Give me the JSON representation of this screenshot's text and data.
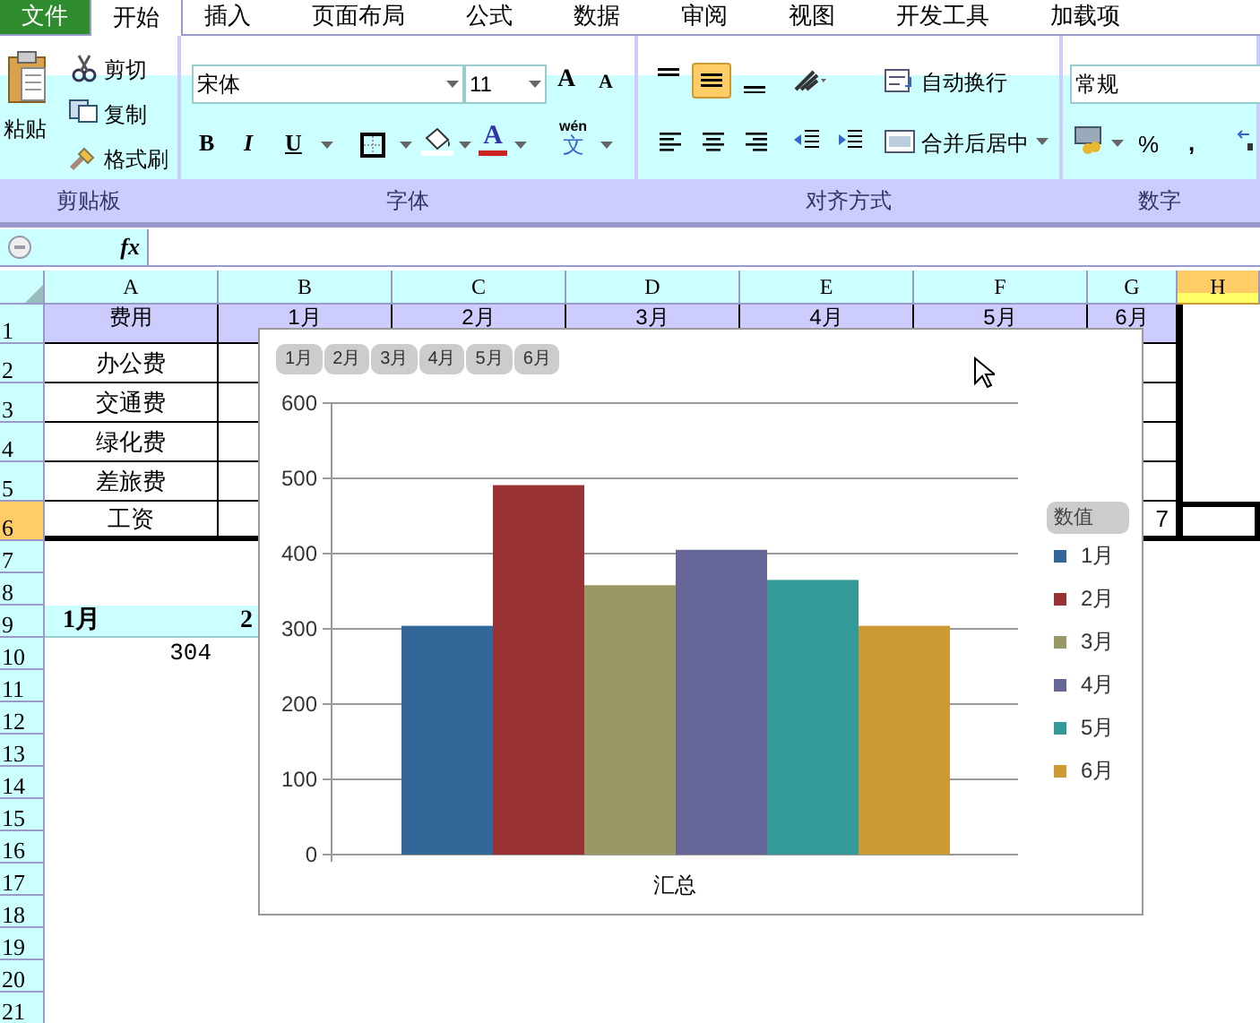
{
  "tabs": [
    {
      "label": "文件",
      "kind": "file",
      "selected": false
    },
    {
      "label": "开始",
      "kind": "tab",
      "selected": true
    },
    {
      "label": "插入",
      "kind": "tab",
      "selected": false
    },
    {
      "label": "页面布局",
      "kind": "tab",
      "selected": false
    },
    {
      "label": "公式",
      "kind": "tab",
      "selected": false
    },
    {
      "label": "数据",
      "kind": "tab",
      "selected": false
    },
    {
      "label": "审阅",
      "kind": "tab",
      "selected": false
    },
    {
      "label": "视图",
      "kind": "tab",
      "selected": false
    },
    {
      "label": "开发工具",
      "kind": "tab",
      "selected": false
    },
    {
      "label": "加载项",
      "kind": "tab",
      "selected": false
    }
  ],
  "clipboard": {
    "paste": "粘贴",
    "cut": "剪切",
    "copy": "复制",
    "format_painter": "格式刷",
    "label": "剪贴板"
  },
  "font": {
    "name": "宋体",
    "size": "11",
    "grow": "A",
    "shrink": "A",
    "bold": "B",
    "italic": "I",
    "underline": "U",
    "font_color": "A",
    "phonetic_top": "wén",
    "phonetic_bottom": "文",
    "label": "字体"
  },
  "alignment": {
    "vertical": [
      {
        "kind": "top",
        "selected": false
      },
      {
        "kind": "middle",
        "selected": true
      },
      {
        "kind": "bottom",
        "selected": false
      }
    ],
    "horizontal": [
      {
        "kind": "left",
        "selected": false
      },
      {
        "kind": "center",
        "selected": false
      },
      {
        "kind": "right",
        "selected": false
      }
    ],
    "wrap": "自动换行",
    "merge": "合并后居中",
    "label": "对齐方式"
  },
  "number": {
    "format": "常规",
    "percent": "%",
    "comma": ",",
    "label": "数字"
  },
  "formula_bar": {
    "function_label": "fx"
  },
  "sheet": {
    "columns": [
      {
        "label": "A",
        "selected": false
      },
      {
        "label": "B",
        "selected": false
      },
      {
        "label": "C",
        "selected": false
      },
      {
        "label": "D",
        "selected": false
      },
      {
        "label": "E",
        "selected": false
      },
      {
        "label": "F",
        "selected": false
      },
      {
        "label": "G",
        "selected": false
      },
      {
        "label": "H",
        "selected": true
      }
    ],
    "rows": [
      {
        "header": "1",
        "kind": "header",
        "selected": false,
        "cells": [
          "费用",
          "1月",
          "2月",
          "3月",
          "4月",
          "5月",
          "6月"
        ]
      },
      {
        "header": "2",
        "kind": "data",
        "selected": false,
        "cells": [
          "办公费"
        ]
      },
      {
        "header": "3",
        "kind": "data",
        "selected": false,
        "cells": [
          "交通费"
        ]
      },
      {
        "header": "4",
        "kind": "data",
        "selected": false,
        "cells": [
          "绿化费"
        ]
      },
      {
        "header": "5",
        "kind": "data",
        "selected": false,
        "cells": [
          "差旅费"
        ]
      },
      {
        "header": "6",
        "kind": "data",
        "selected": true,
        "cells": [
          "工资",
          null,
          null,
          null,
          null,
          null,
          "7"
        ]
      },
      {
        "header": "7",
        "kind": "plain",
        "selected": false,
        "cells": []
      },
      {
        "header": "8",
        "kind": "plain",
        "selected": false,
        "cells": []
      },
      {
        "header": "9",
        "kind": "pivot",
        "selected": false,
        "cells": [
          "1月",
          "2"
        ]
      },
      {
        "header": "10",
        "kind": "value",
        "selected": false,
        "cells": [
          "304"
        ]
      },
      {
        "header": "11",
        "kind": "plain",
        "selected": false,
        "cells": []
      },
      {
        "header": "12",
        "kind": "plain",
        "selected": false,
        "cells": []
      },
      {
        "header": "13",
        "kind": "plain",
        "selected": false,
        "cells": []
      },
      {
        "header": "14",
        "kind": "plain",
        "selected": false,
        "cells": []
      },
      {
        "header": "15",
        "kind": "plain",
        "selected": false,
        "cells": []
      },
      {
        "header": "16",
        "kind": "plain",
        "selected": false,
        "cells": []
      },
      {
        "header": "17",
        "kind": "plain",
        "selected": false,
        "cells": []
      },
      {
        "header": "18",
        "kind": "plain",
        "selected": false,
        "cells": []
      },
      {
        "header": "19",
        "kind": "plain",
        "selected": false,
        "cells": []
      },
      {
        "header": "20",
        "kind": "plain",
        "selected": false,
        "cells": []
      },
      {
        "header": "21",
        "kind": "plain",
        "selected": false,
        "cells": []
      }
    ]
  },
  "chart": {
    "field_buttons": [
      "1月",
      "2月",
      "3月",
      "4月",
      "5月",
      "6月"
    ],
    "legend_title": "数值",
    "chart_data": {
      "type": "bar",
      "grid": true,
      "legend": true,
      "categories": [
        "汇总"
      ],
      "ylim": [
        0,
        600
      ],
      "yticks": [
        0,
        100,
        200,
        300,
        400,
        500,
        600
      ],
      "series": [
        {
          "name": "1月",
          "color": "#336699",
          "values": [
            304
          ]
        },
        {
          "name": "2月",
          "color": "#993333",
          "values": [
            491
          ]
        },
        {
          "name": "3月",
          "color": "#999966",
          "values": [
            358
          ]
        },
        {
          "name": "4月",
          "color": "#666699",
          "values": [
            405
          ]
        },
        {
          "name": "5月",
          "color": "#339999",
          "values": [
            365
          ]
        },
        {
          "name": "6月",
          "color": "#cc9933",
          "values": [
            304
          ]
        }
      ]
    }
  }
}
